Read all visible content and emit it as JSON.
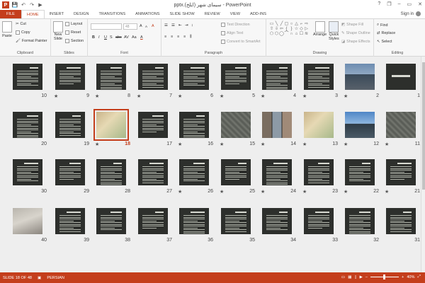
{
  "window": {
    "title": "pptx.سیمای شهر (ایلخ) - PowerPoint",
    "minimize_glyph": "–",
    "maximize_glyph": "▭",
    "close_glyph": "✕",
    "help_glyph": "?",
    "restore_glyph": "❐"
  },
  "quick_access": {
    "logo_letter": "P",
    "save_icon": "💾",
    "undo_icon": "↶",
    "redo_icon": "↷",
    "start_icon": "▶"
  },
  "tabs": [
    "FILE",
    "HOME",
    "INSERT",
    "DESIGN",
    "TRANSITIONS",
    "ANIMATIONS",
    "SLIDE SHOW",
    "REVIEW",
    "VIEW",
    "ADD-INS"
  ],
  "active_tab": "HOME",
  "signin": "Sign in",
  "ribbon": {
    "clipboard": {
      "label": "Clipboard",
      "paste": "Paste",
      "cut": "Cut",
      "copy": "Copy",
      "format_painter": "Format Painter"
    },
    "slides": {
      "label": "Slides",
      "new_slide": "New",
      "new_slide_2": "Slide",
      "layout": "Layout",
      "reset": "Reset",
      "section": "Section"
    },
    "font": {
      "label": "Font",
      "font_size": "48",
      "bold": "B",
      "italic": "I",
      "underline": "U",
      "shadow": "S",
      "strike": "abc",
      "spacing": "AV",
      "case": "Aa",
      "clear": "A",
      "grow": "A",
      "shrink": "A"
    },
    "paragraph": {
      "label": "Paragraph",
      "text_direction": "Text Direction",
      "align_text": "Align Text",
      "convert_smartart": "Convert to SmartArt"
    },
    "drawing": {
      "label": "Drawing",
      "arrange": "Arrange",
      "quick_styles": "Quick",
      "quick_styles_2": "Styles",
      "shape_fill": "Shape Fill",
      "shape_outline": "Shape Outline",
      "shape_effects": "Shape Effects"
    },
    "editing": {
      "label": "Editing",
      "find": "Find",
      "replace": "Replace",
      "select": "Select"
    }
  },
  "slides": [
    {
      "n": "1",
      "star": "",
      "kind": "title"
    },
    {
      "n": "2",
      "star": "★",
      "kind": "city"
    },
    {
      "n": "3",
      "star": "★",
      "kind": "text"
    },
    {
      "n": "4",
      "star": "★",
      "kind": "text"
    },
    {
      "n": "5",
      "star": "★",
      "kind": "text"
    },
    {
      "n": "6",
      "star": "★",
      "kind": "text"
    },
    {
      "n": "7",
      "star": "★",
      "kind": "text"
    },
    {
      "n": "8",
      "star": "★",
      "kind": "text"
    },
    {
      "n": "9",
      "star": "★",
      "kind": "text"
    },
    {
      "n": "10",
      "star": "",
      "kind": "text"
    },
    {
      "n": "11",
      "star": "★",
      "kind": "aerial"
    },
    {
      "n": "12",
      "star": "★",
      "kind": "skyline"
    },
    {
      "n": "13",
      "star": "★",
      "kind": "map"
    },
    {
      "n": "14",
      "star": "★",
      "kind": "photos"
    },
    {
      "n": "15",
      "star": "★",
      "kind": "aerial"
    },
    {
      "n": "16",
      "star": "★",
      "kind": "text"
    },
    {
      "n": "17",
      "star": "",
      "kind": "text"
    },
    {
      "n": "18",
      "star": "★",
      "kind": "map",
      "selected": true
    },
    {
      "n": "19",
      "star": "",
      "kind": "text"
    },
    {
      "n": "20",
      "star": "",
      "kind": "text"
    },
    {
      "n": "21",
      "star": "★",
      "kind": "text"
    },
    {
      "n": "22",
      "star": "★",
      "kind": "text"
    },
    {
      "n": "23",
      "star": "★",
      "kind": "text"
    },
    {
      "n": "24",
      "star": "★",
      "kind": "text"
    },
    {
      "n": "25",
      "star": "★",
      "kind": "text"
    },
    {
      "n": "26",
      "star": "★",
      "kind": "text"
    },
    {
      "n": "27",
      "star": "",
      "kind": "text"
    },
    {
      "n": "28",
      "star": "",
      "kind": "text"
    },
    {
      "n": "29",
      "star": "",
      "kind": "text"
    },
    {
      "n": "30",
      "star": "",
      "kind": "text"
    },
    {
      "n": "31",
      "star": "",
      "kind": "text"
    },
    {
      "n": "32",
      "star": "",
      "kind": "text"
    },
    {
      "n": "33",
      "star": "",
      "kind": "text"
    },
    {
      "n": "34",
      "star": "",
      "kind": "text"
    },
    {
      "n": "35",
      "star": "",
      "kind": "text"
    },
    {
      "n": "36",
      "star": "",
      "kind": "text"
    },
    {
      "n": "37",
      "star": "",
      "kind": "text"
    },
    {
      "n": "38",
      "star": "",
      "kind": "text"
    },
    {
      "n": "39",
      "star": "",
      "kind": "text"
    },
    {
      "n": "40",
      "star": "",
      "kind": "laptop"
    }
  ],
  "status": {
    "slide_info": "SLIDE 18 OF 48",
    "language": "PERSIAN",
    "zoom": "40%",
    "zoom_minus": "–",
    "zoom_plus": "+"
  },
  "colors": {
    "accent": "#c43e1c",
    "slide_bg": "#2d2f2c",
    "sorter_bg": "#eeeeee"
  }
}
